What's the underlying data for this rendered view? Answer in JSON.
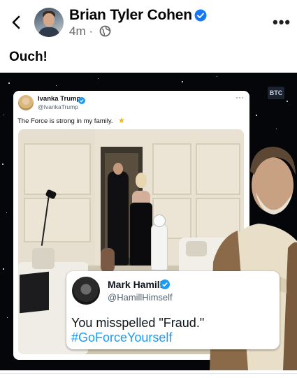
{
  "post": {
    "author": "Brian Tyler Cohen",
    "time": "4m ·",
    "caption": "Ouch!",
    "more_glyph": "•••"
  },
  "image": {
    "watermark": "BTC",
    "tweet": {
      "name": "Ivanka Trump",
      "handle": "@IvankaTrump",
      "text": "The Force is strong in my family.",
      "emoji": "★",
      "more_glyph": "···"
    },
    "reply": {
      "name": "Mark Hamill",
      "handle": "@HamillHimself",
      "text": "You misspelled \"Fraud.\"",
      "hashtag": "#GoForceYourself"
    }
  },
  "colors": {
    "verified": "#1877f2",
    "twitter_verified": "#1d9bf0",
    "hashtag": "#1d9bf0",
    "meta_text": "#65676b"
  },
  "icons": [
    "back-arrow-icon",
    "verified-badge-icon",
    "globe-icon",
    "more-options-icon"
  ]
}
